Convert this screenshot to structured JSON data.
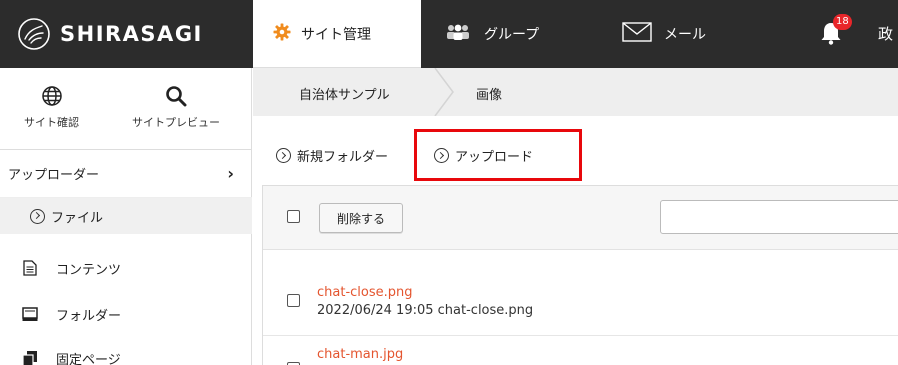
{
  "header": {
    "logo_text": "SHIRASAGI",
    "site_admin_label": "サイト管理",
    "group_label": "グループ",
    "mail_label": "メール",
    "notification_count": "18",
    "user_initial": "政",
    "colors": {
      "topbar": "#2c2c2c",
      "badge": "#e8262a",
      "site_icon": "#f08c1e"
    }
  },
  "sidebar": {
    "site_check_label": "サイト確認",
    "site_preview_label": "サイトプレビュー",
    "uploader_label": "アップローダー",
    "file_label": "ファイル",
    "links": [
      {
        "label": "コンテンツ",
        "icon": "document-icon"
      },
      {
        "label": "フォルダー",
        "icon": "folder-icon"
      },
      {
        "label": "固定ページ",
        "icon": "pages-icon"
      }
    ]
  },
  "breadcrumb": {
    "items": [
      "自治体サンプル",
      "画像"
    ]
  },
  "toolbar": {
    "new_folder_label": "新規フォルダー",
    "upload_label": "アップロード",
    "highlight_color": "#e8080c"
  },
  "list": {
    "delete_label": "削除する",
    "search_value": "",
    "items": [
      {
        "name": "chat-close.png",
        "meta": "2022/06/24 19:05 chat-close.png"
      },
      {
        "name": "chat-man.jpg",
        "meta": ""
      }
    ],
    "link_color": "#e4552f"
  }
}
